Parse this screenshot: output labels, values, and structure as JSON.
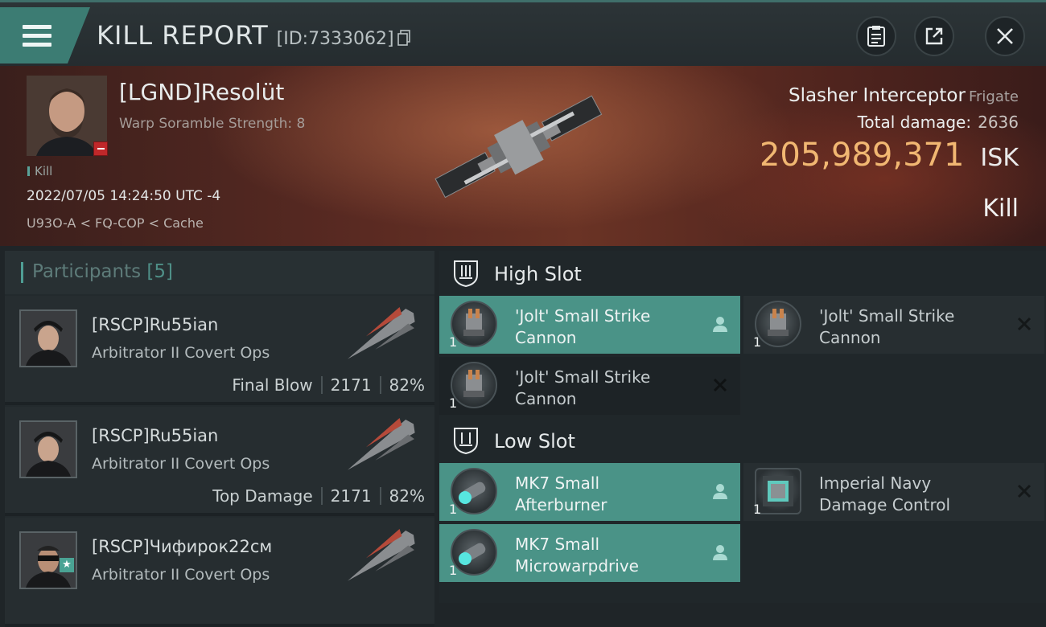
{
  "header": {
    "title": "KILL REPORT",
    "id_label": "[ID:7333062]"
  },
  "victim": {
    "name": "[LGND]Resolüt",
    "subtitle": "Warp Soramble Strength: 8",
    "tag": "Kill",
    "datetime": "2022/07/05 14:24:50 UTC -4",
    "location": "U93O-A < FQ-COP < Cache",
    "ship_name": "Slasher Interceptor",
    "ship_class": "Frigate",
    "total_damage_label": "Total damage:",
    "total_damage": "2636",
    "isk_value": "205,989,371",
    "isk_unit": "ISK",
    "result": "Kill"
  },
  "participants": {
    "label": "Participants",
    "count": "[5]",
    "rows": [
      {
        "name": "[RSCP]Ru55ian",
        "ship": "Arbitrator II Covert Ops",
        "role": "Final Blow",
        "damage": "2171",
        "percent": "82%"
      },
      {
        "name": "[RSCP]Ru55ian",
        "ship": "Arbitrator II Covert Ops",
        "role": "Top Damage",
        "damage": "2171",
        "percent": "82%"
      },
      {
        "name": "[RSCP]Чифирок22см",
        "ship": "Arbitrator II Covert Ops"
      }
    ]
  },
  "fitting": {
    "high_slot_label": "High Slot",
    "low_slot_label": "Low Slot",
    "high": [
      {
        "qty": "1",
        "name_line1": "'Jolt' Small Strike",
        "name_line2": "Cannon",
        "state": "fitted"
      },
      {
        "qty": "1",
        "name_line1": "'Jolt' Small Strike",
        "name_line2": "Cannon",
        "state": "destroyed"
      },
      {
        "qty": "1",
        "name_line1": "'Jolt' Small Strike",
        "name_line2": "Cannon",
        "state": "destroyed"
      }
    ],
    "low": [
      {
        "qty": "1",
        "name_line1": "MK7 Small",
        "name_line2": "Afterburner",
        "state": "fitted"
      },
      {
        "qty": "1",
        "name_line1": "Imperial Navy",
        "name_line2": "Damage Control",
        "state": "destroyed"
      },
      {
        "qty": "1",
        "name_line1": "MK7 Small",
        "name_line2": "Microwarpdrive",
        "state": "fitted"
      }
    ]
  },
  "colors": {
    "accent": "#4a9387",
    "isk": "#f1b772",
    "hero_bg": "#5a2a22"
  }
}
